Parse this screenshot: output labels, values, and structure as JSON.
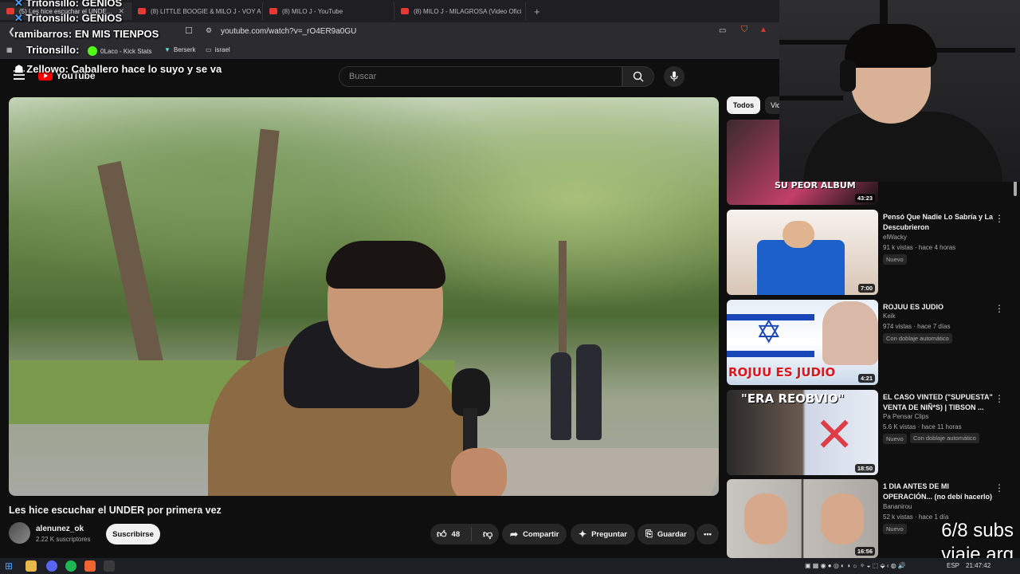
{
  "browser": {
    "tabs": [
      {
        "label": "(5) Les hice escuchar el UNDE..."
      },
      {
        "label": "(8) LITTLE BOOGIE & MILO J - VOY A"
      },
      {
        "label": "(8) MILO J - YouTube"
      },
      {
        "label": "(8) MILO J - MILAGROSA (Video Ofici"
      }
    ],
    "new_tab": "+",
    "url": "youtube.com/watch?v=_rO4ER9a0GU",
    "bookmarks": [
      {
        "label": "Berserk",
        "icon": "berserk-icon"
      },
      {
        "label": "0Laco - Kick Stats",
        "icon": "kick-icon"
      },
      {
        "label": "israel",
        "icon": "folder-icon"
      }
    ]
  },
  "youtube": {
    "logo_text": "YouTube",
    "search_placeholder": "Buscar",
    "video_title": "Les hice escuchar el UNDER por primera vez",
    "channel_name": "alenunez_ok",
    "channel_subs": "2.22 K suscriptores",
    "subscribe_label": "Suscribirse",
    "likes": "48",
    "share_label": "Compartir",
    "ask_label": "Preguntar",
    "save_label": "Guardar",
    "chips": [
      "Todos",
      "Vid"
    ],
    "recommendations": [
      {
        "title": "",
        "channel": "",
        "meta": "",
        "duration": "43:23",
        "thumb_text": "SU PEOR ALBUM",
        "badges": []
      },
      {
        "title": "Pensó Que Nadie Lo Sabría y La Descubrieron",
        "channel": "elWacky",
        "meta": "91 k vistas · hace 4 horas",
        "duration": "7:00",
        "thumb_text": "",
        "badges": [
          "Nuevo"
        ]
      },
      {
        "title": "ROJUU ES JUDIO",
        "channel": "Keik",
        "meta": "974 vistas · hace 7 días",
        "duration": "4:21",
        "thumb_text": "ROJUU ES JUDIO",
        "badges": [
          "Con doblaje automático"
        ]
      },
      {
        "title": "EL CASO VINTED (\"SUPUESTA\" VENTA DE NIÑ*S) | TIBSON ...",
        "channel": "Pa Pensar Clips",
        "meta": "5.6 K vistas · hace 11 horas",
        "duration": "18:50",
        "thumb_text": "\"ERA REOBVIO\"",
        "badges": [
          "Nuevo",
          "Con doblaje automático"
        ]
      },
      {
        "title": "1 DIA ANTES DE MI OPERACIÓN... (no debí hacerlo)",
        "channel": "Bananirou",
        "meta": "52 k vistas · hace 1 día",
        "duration": "16:56",
        "thumb_text": "",
        "badges": [
          "Nuevo"
        ]
      }
    ]
  },
  "chat": [
    {
      "user": "Tritonsillo",
      "text": "GENIOS"
    },
    {
      "user": "Tritonsillo",
      "text": "GENIOS"
    },
    {
      "user": "ramibarros",
      "text": "EN MIS TIENPOS"
    },
    {
      "user": "Tritonsillo",
      "text": ""
    },
    {
      "user": "Zellowo",
      "text": "Caballero hace lo suyo y se va"
    }
  ],
  "overlay": {
    "subs_goal": "6/8 subs",
    "subtitle": "viaje arg"
  },
  "taskbar": {
    "language": "ESP",
    "time": "21:47:42"
  },
  "colors": {
    "accent_red": "#ff0000",
    "background": "#0f0f0f"
  }
}
